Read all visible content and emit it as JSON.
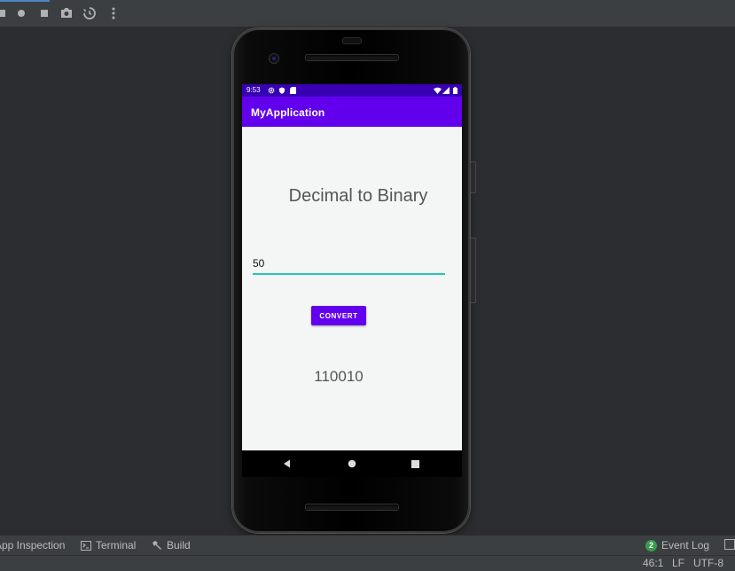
{
  "toolbar": {
    "buttons": [
      "rerun-icon",
      "record-icon",
      "stop-icon",
      "camera-icon",
      "rotate-icon",
      "more-vert-icon"
    ]
  },
  "phone_screen": {
    "status_time": "9:53",
    "app_title": "MyApplication",
    "heading": "Decimal to Binary",
    "input_value": "50",
    "convert_button": "CONVERT",
    "result": "110010"
  },
  "bottom_tools": {
    "app_inspection": "App Inspection",
    "terminal": "Terminal",
    "build": "Build",
    "event_log_count": "2",
    "event_log": "Event Log"
  },
  "status_bar": {
    "caret_position": "46:1",
    "line_separator": "LF",
    "encoding": "UTF-8"
  },
  "colors": {
    "ide_background": "#2b2d30",
    "status_bar_purple": "#3700b3",
    "app_bar_purple": "#6200ee",
    "input_underline": "#26c6b4",
    "screen_background": "#f3f6f4"
  }
}
